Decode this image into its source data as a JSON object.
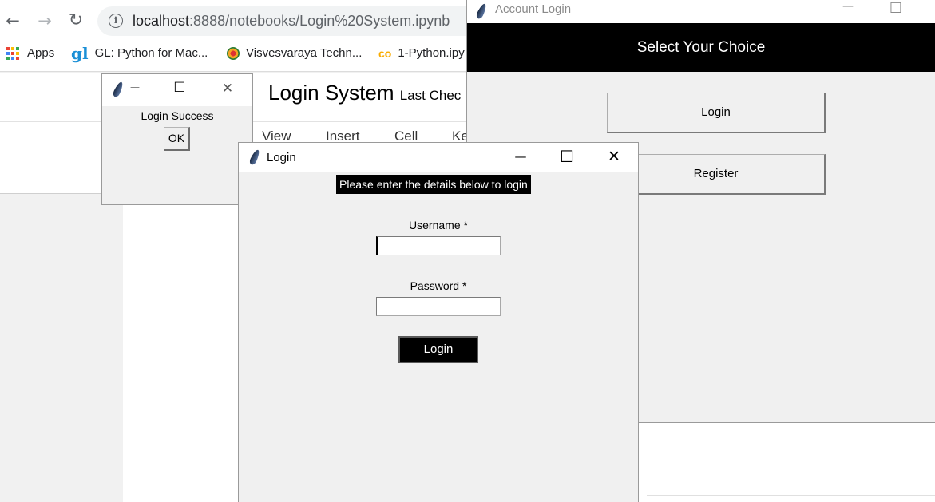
{
  "browser": {
    "url_host": "localhost",
    "url_rest": ":8888/notebooks/Login%20System.ipynb",
    "nav": {
      "back": "←",
      "forward": "→",
      "reload": "↻"
    },
    "bookmarks": [
      {
        "label": "Apps",
        "icon": "apps-grid-icon"
      },
      {
        "label": "GL: Python for Mac...",
        "icon": "gl-logo-icon"
      },
      {
        "label": "Visvesvaraya Techn...",
        "icon": "vtu-logo-icon"
      },
      {
        "label": "1-Python.ipy",
        "icon": "colab-icon"
      }
    ]
  },
  "jupyter": {
    "title": "Login System",
    "checkpoint": "Last Chec",
    "menu": [
      "View",
      "Insert",
      "Cell",
      "Ke"
    ]
  },
  "account_window": {
    "title": "Account Login",
    "header": "Select Your Choice",
    "login_button": "Login",
    "register_button": "Register",
    "controls": {
      "minimize": "—",
      "maximize": "☐"
    }
  },
  "msgbox": {
    "message": "Login Success",
    "ok_button": "OK",
    "controls": {
      "minimize": "—",
      "maximize": "☐",
      "close": "✕"
    }
  },
  "login_window": {
    "title": "Login",
    "banner": "Please enter the details below to login",
    "username_label": "Username *",
    "username_value": "",
    "password_label": "Password *",
    "password_value": "",
    "submit_button": "Login",
    "controls": {
      "minimize": "—",
      "maximize": "☐",
      "close": "✕"
    }
  },
  "colors": {
    "header_bg": "#000000",
    "window_bg": "#f0f0f0",
    "omnibox_bg": "#f1f3f4",
    "accent_orange": "#f9ab00"
  }
}
